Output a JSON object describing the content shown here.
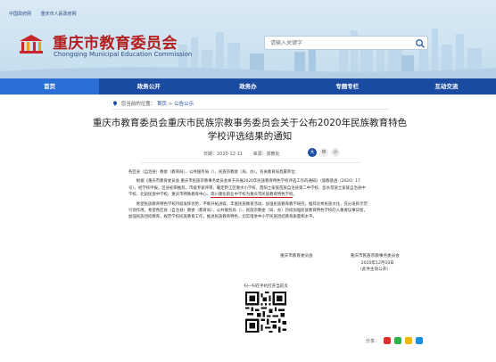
{
  "header": {
    "top_links": [
      "中国政府网",
      "重庆市人民政府网"
    ],
    "title": "重庆市教育委员会",
    "subtitle": "Chongqing Municipal Education Commission",
    "search_placeholder": "请输入关键字"
  },
  "nav": {
    "items": [
      "首页",
      "政务公开",
      "政务办",
      "专题专栏",
      "互动交流"
    ]
  },
  "breadcrumb": {
    "current_label": "您当前的位置：",
    "home": "首页",
    "sep": ">",
    "section": "公告公示"
  },
  "article": {
    "title": "重庆市教育委员会重庆市民族宗教事务委员会关于公布2020年民族教育特色学校评选结果的通知",
    "date": "日期：2020-12-11",
    "source": "来源：高教处",
    "font_sizes": [
      "大",
      "中",
      "小"
    ],
    "addressee": "各区县（自治县）教委（教育局）、公共服务局（）、民族宗教委（局、办），有关教育局直属单位：",
    "para1_start": "根据《重庆市教育委员会 重庆市民族宗教事务委员会关于开展2020年民族教育特色学校评选工作的通知》（渝教基函〔2020〕17号），经学校申报，区县初审推荐，市级专家评审，确定黔江区重水小学校、酉阳土家族苗族自治县第二中学校、彭水苗族土家族自治县中学校、北碚民族中学校、重庆市特殊教育中心、",
    "para1_highlight": "南川隆化职业中学校为重庆市民族教育特色学校",
    "para1_end": "。",
    "para2": "希望民族教育特色学校持续发挥优势，不断开拓进取，丰富民族教育活动，加强民族教育教学研究，推荐优秀民族文化，充分发挥示范引领作用。希望各区县（自治县）教委（教育局）、公共服务局（）、民族宗教委（局、办）持续加强民族教育特色学校的入重要议事日程，加强民族团结教育，规范学校民族教育工作，推进民族教育特色，切实增进中小学民族团结教育质量和水平。",
    "signer_left": "重庆市教育委员会",
    "signer_right": "重庆市民族宗教事务委员会",
    "sign_date": "2020年12月10日",
    "disclosure": "（此件主动公开）"
  },
  "qr": {
    "label": "扫一扫在手机打开当前页"
  },
  "share": {
    "label": "分享："
  },
  "colors": {
    "nav_bg": "#1a4ba0",
    "nav_active": "#2b6fd6",
    "title_red": "#b41e1e",
    "highlight_underline": "#d21f1f"
  }
}
